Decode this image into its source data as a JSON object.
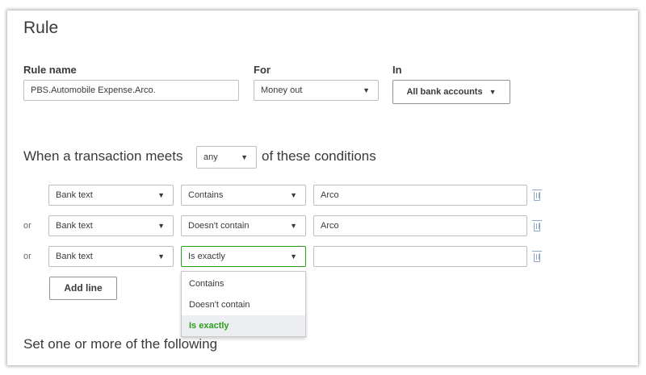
{
  "title": "Rule",
  "rule_name": {
    "label": "Rule name",
    "value": "PBS.Automobile Expense.Arco."
  },
  "for": {
    "label": "For",
    "value": "Money out"
  },
  "in": {
    "label": "In",
    "button_label": "All bank accounts"
  },
  "conditions_sentence": {
    "prefix": "When a transaction meets",
    "match_value": "any",
    "suffix": "of these conditions"
  },
  "conditions": [
    {
      "connector": "",
      "field": "Bank text",
      "operator": "Contains",
      "value": "Arco"
    },
    {
      "connector": "or",
      "field": "Bank text",
      "operator": "Doesn't contain",
      "value": "Arco"
    },
    {
      "connector": "or",
      "field": "Bank text",
      "operator": "Is exactly",
      "value": ""
    }
  ],
  "add_line_label": "Add line",
  "operator_dropdown": {
    "options": [
      "Contains",
      "Doesn't contain",
      "Is exactly"
    ],
    "selected": "Is exactly"
  },
  "set_heading": "Set one or more of the following",
  "colors": {
    "accent_green": "#2ca01c",
    "trash_icon": "#8ea9c8",
    "text": "#393a3d"
  },
  "icons": {
    "select_caret": "chevron-down-icon",
    "delete": "trash-icon"
  }
}
